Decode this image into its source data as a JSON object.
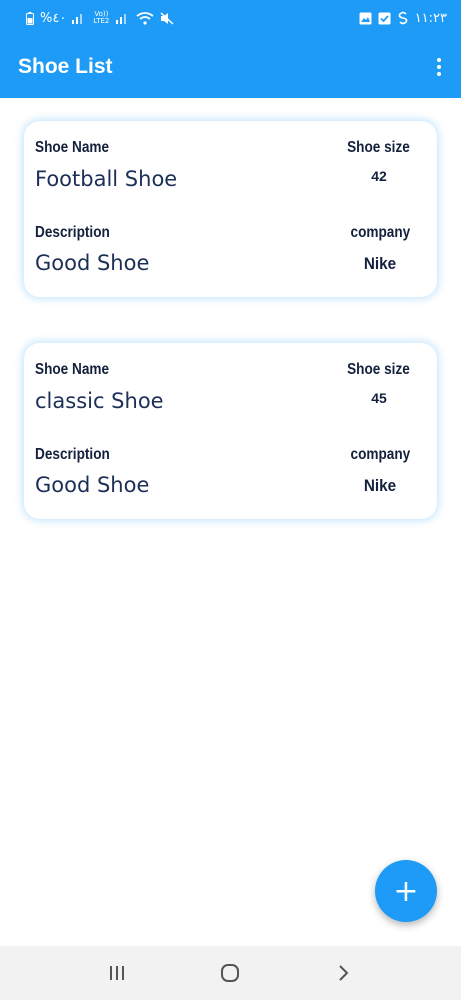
{
  "status_bar": {
    "left_text": "%٤٠",
    "network_label": "Vo)) LTE2",
    "time": "١١:٢٣"
  },
  "app_bar": {
    "title": "Shoe List"
  },
  "labels": {
    "shoe_name": "Shoe Name",
    "shoe_size": "Shoe size",
    "description": "Description",
    "company": "company"
  },
  "shoes": [
    {
      "name": "Football Shoe",
      "size": "42",
      "description": "Good Shoe",
      "company": "Nike"
    },
    {
      "name": "classic Shoe",
      "size": "45",
      "description": "Good Shoe",
      "company": "Nike"
    }
  ],
  "fab": {
    "icon": "plus-icon",
    "label": "+"
  },
  "colors": {
    "primary": "#1e9bf6",
    "text_dark": "#14213d",
    "text_value": "#1c2f57",
    "nav_bg": "#f2f2f2"
  }
}
